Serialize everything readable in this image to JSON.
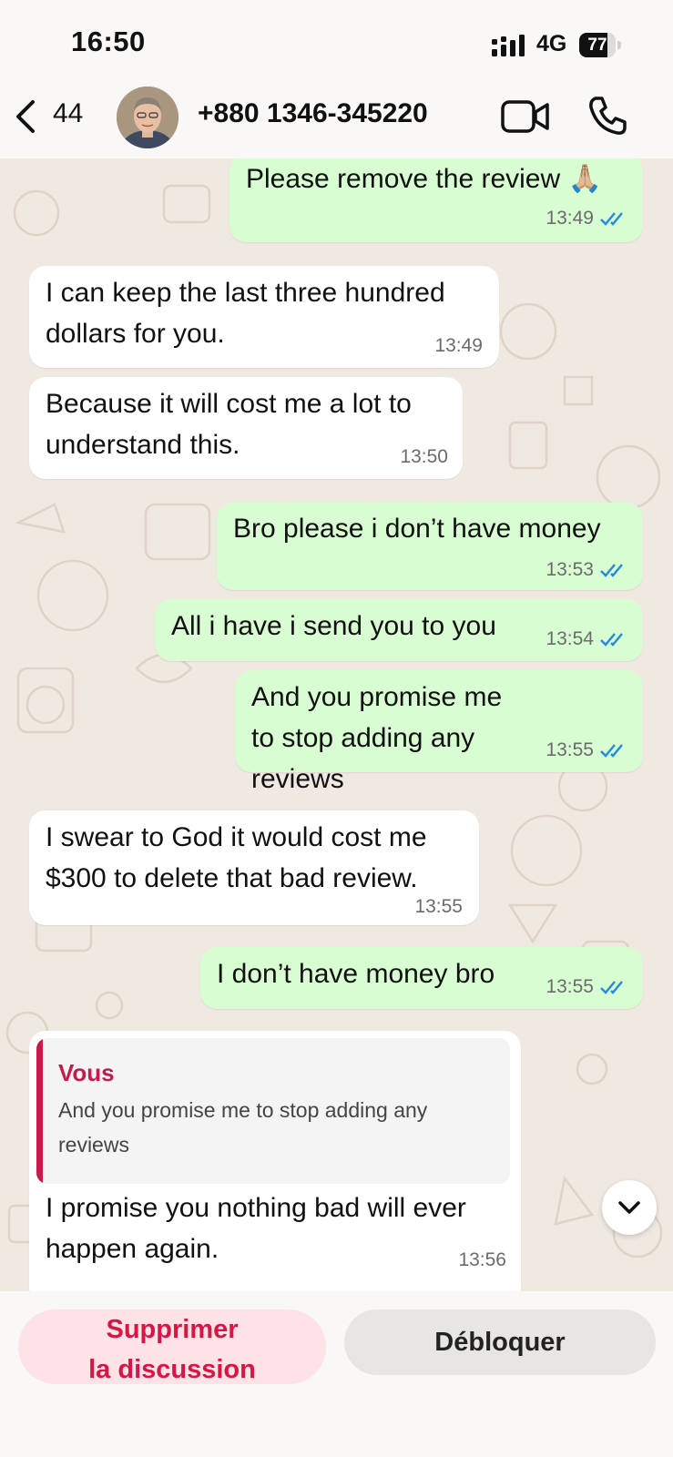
{
  "status": {
    "time": "16:50",
    "network": "4G",
    "battery": "77",
    "battery_level": 0.77
  },
  "header": {
    "back_count": "44",
    "contact": "+880 1346-345220",
    "icons": [
      "chevron-left-icon",
      "avatar",
      "video-call-icon",
      "phone-icon"
    ]
  },
  "messages": [
    {
      "dir": "out",
      "text": "Please remove the review 🙏🏼",
      "time": "13:49",
      "read": true
    },
    {
      "dir": "in",
      "text": "I can keep the last three hundred dollars for you.",
      "time": "13:49"
    },
    {
      "dir": "in",
      "text": "Because it will cost me a lot to understand this.",
      "time": "13:50"
    },
    {
      "dir": "out",
      "text": "Bro please i don’t have money",
      "time": "13:53",
      "read": true
    },
    {
      "dir": "out",
      "text": "All i have i send you to you",
      "time": "13:54",
      "read": true
    },
    {
      "dir": "out",
      "text": "And you promise me to stop adding any reviews",
      "time": "13:55",
      "read": true
    },
    {
      "dir": "in",
      "text": "I swear to God it would cost me $300 to delete that bad review.",
      "time": "13:55"
    },
    {
      "dir": "out",
      "text": "I don’t have money bro",
      "time": "13:55",
      "read": true
    },
    {
      "dir": "in",
      "reply_to": {
        "sender": "Vous",
        "text": "And you promise me to stop adding any reviews"
      },
      "text": "I promise you nothing bad will ever happen again.",
      "time": "13:56"
    }
  ],
  "actions": {
    "delete_line1": "Supprimer",
    "delete_line2": "la discussion",
    "unblock": "Débloquer"
  },
  "colors": {
    "outgoing_bubble": "#d9fdd3",
    "incoming_bubble": "#ffffff",
    "read_tick": "#2a8bd8",
    "danger": "#d81645"
  }
}
